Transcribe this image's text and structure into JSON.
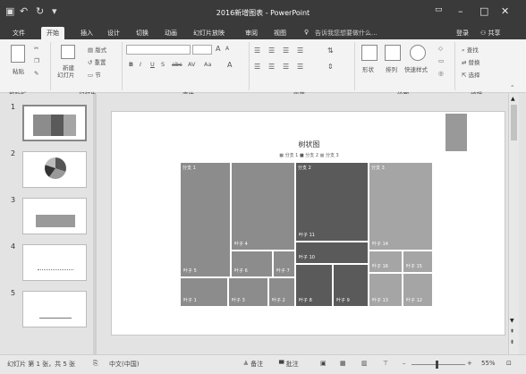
{
  "window": {
    "title": "2016新增图表 - PowerPoint",
    "quick_access": [
      "save-icon",
      "undo-icon",
      "redo-icon",
      "customize-icon"
    ],
    "controls": [
      "ribbon-display-icon",
      "minimize-icon",
      "maximize-icon",
      "close-icon"
    ]
  },
  "tabs": [
    "文件",
    "开始",
    "插入",
    "设计",
    "切换",
    "动画",
    "幻灯片放映",
    "审阅",
    "视图"
  ],
  "active_tab": "开始",
  "tell_me": "告诉我您想要做什么...",
  "account": {
    "login": "登录",
    "share": "共享"
  },
  "ribbon": {
    "clipboard": {
      "paste": "粘贴",
      "group": "剪贴板"
    },
    "slides": {
      "new_slide": "新建",
      "new_slide2": "幻灯片",
      "layout": "版式",
      "reset": "重置",
      "section": "节",
      "group": "幻灯片"
    },
    "font": {
      "group": "字体",
      "grow": "A",
      "shrink": "A",
      "bold": "B",
      "italic": "I",
      "underline": "U",
      "shadow": "S",
      "strike": "abc",
      "spacing": "AV",
      "case": "Aa",
      "color": "A"
    },
    "paragraph": {
      "group": "段落"
    },
    "drawing": {
      "shape": "形状",
      "arrange": "排列",
      "quick_style": "快速样式",
      "group": "绘图"
    },
    "editing": {
      "find": "查找",
      "replace": "替换",
      "select": "选择",
      "group": "编辑"
    }
  },
  "thumbnails": [
    {
      "num": "1",
      "selected": true
    },
    {
      "num": "2",
      "selected": false
    },
    {
      "num": "3",
      "selected": false
    },
    {
      "num": "4",
      "selected": false
    },
    {
      "num": "5",
      "selected": false
    }
  ],
  "chart_data": {
    "type": "treemap",
    "title": "树状图",
    "legend": [
      "分支 1",
      "分支 2",
      "分支 3"
    ],
    "groups": [
      {
        "name": "分支 1",
        "color": "#8c8c8c",
        "leaves": [
          "叶子 5",
          "叶子 4",
          "叶子 6",
          "叶子 7",
          "叶子 1",
          "叶子 3",
          "叶子 2"
        ]
      },
      {
        "name": "分支 2",
        "color": "#5a5a5a",
        "leaves": [
          "叶子 11",
          "叶子 10",
          "叶子 8",
          "叶子 9"
        ]
      },
      {
        "name": "分支 3",
        "color": "#a5a5a5",
        "leaves": [
          "叶子 14",
          "叶子 16",
          "叶子 15",
          "叶子 13",
          "叶子 12"
        ]
      }
    ]
  },
  "status": {
    "slide_info": "幻灯片 第 1 张，共 5 张",
    "language": "中文(中国)",
    "notes": "备注",
    "comments": "批注",
    "zoom": "55%"
  }
}
